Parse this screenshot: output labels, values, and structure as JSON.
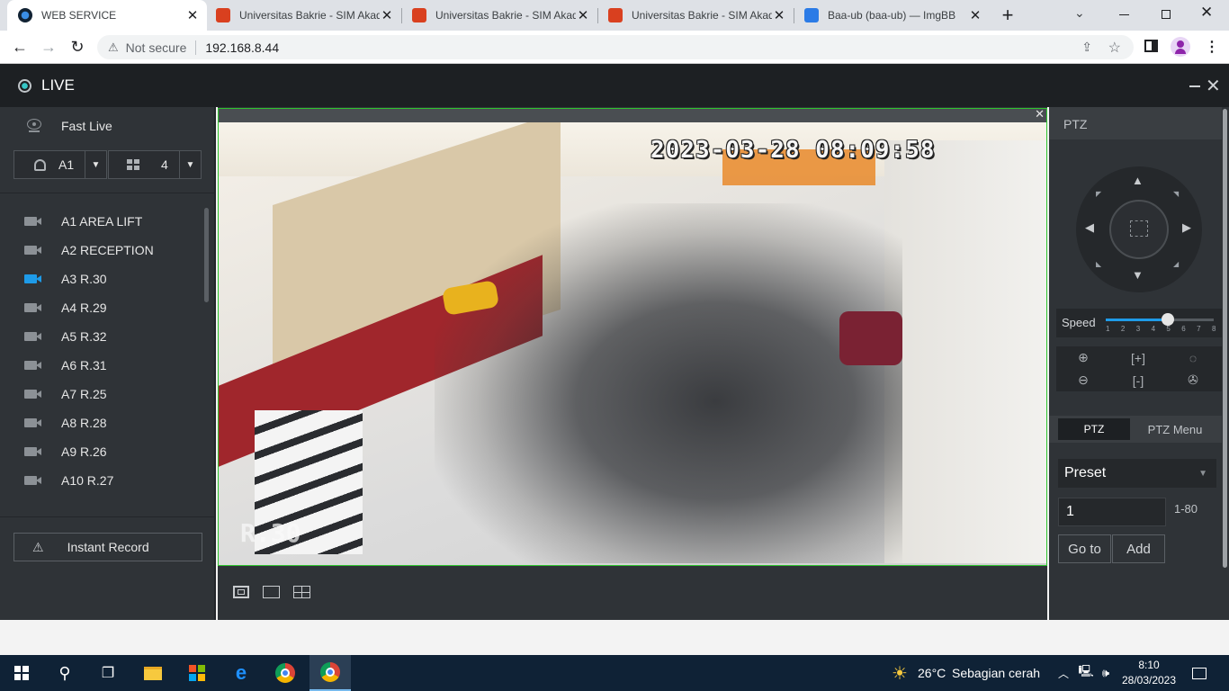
{
  "browser": {
    "tabs": [
      {
        "title": "WEB SERVICE",
        "favicon": "dahua-icon",
        "active": true
      },
      {
        "title": "Universitas Bakrie - SIM Akad",
        "favicon": "shield-icon"
      },
      {
        "title": "Universitas Bakrie - SIM Akad",
        "favicon": "shield-icon"
      },
      {
        "title": "Universitas Bakrie - SIM Akad",
        "favicon": "shield-icon"
      },
      {
        "title": "Baa-ub (baa-ub) — ImgBB",
        "favicon": "ibb-icon"
      }
    ],
    "security_label": "Not secure",
    "url": "192.168.8.44"
  },
  "app": {
    "title": "LIVE",
    "fast_live_label": "Fast Live",
    "channel_select": "A1",
    "layout_select": "4",
    "cameras": [
      {
        "label": "A1 AREA LIFT",
        "selected": false
      },
      {
        "label": "A2 RECEPTION",
        "selected": false
      },
      {
        "label": "A3 R.30",
        "selected": true
      },
      {
        "label": "A4 R.29",
        "selected": false
      },
      {
        "label": "A5 R.32",
        "selected": false
      },
      {
        "label": "A6 R.31",
        "selected": false
      },
      {
        "label": "A7 R.25",
        "selected": false
      },
      {
        "label": "A8 R.28",
        "selected": false
      },
      {
        "label": "A9 R.26",
        "selected": false
      },
      {
        "label": "A10 R.27",
        "selected": false
      }
    ],
    "instant_record_label": "Instant Record",
    "video": {
      "timestamp": "2023-03-28 08:09:58",
      "camera_overlay": "R.30"
    },
    "ptz": {
      "title": "PTZ",
      "speed_label": "Speed",
      "speed_ticks": [
        "1",
        "2",
        "3",
        "4",
        "5",
        "6",
        "7",
        "8"
      ],
      "speed_value": 5,
      "tabs": [
        "PTZ",
        "PTZ Menu"
      ],
      "active_tab": "PTZ",
      "preset_select": "Preset",
      "preset_value": "1",
      "preset_range": "1-80",
      "goto_label": "Go to",
      "add_label": "Add"
    }
  },
  "taskbar": {
    "weather_temp": "26°C",
    "weather_desc": "Sebagian cerah",
    "time": "8:10",
    "date": "28/03/2023"
  },
  "colors": {
    "accent_blue": "#1e9be8",
    "selection_green": "#2ec42e",
    "panel_bg": "#2f3337",
    "header_bg": "#1d2023"
  }
}
